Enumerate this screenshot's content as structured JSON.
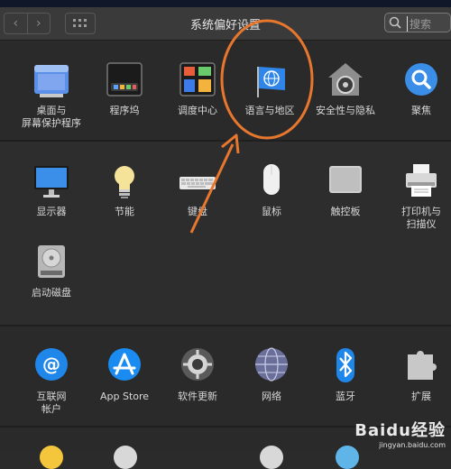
{
  "window": {
    "title": "系统偏好设置"
  },
  "toolbar": {
    "back": "‹",
    "forward": "›"
  },
  "search": {
    "placeholder": "搜索"
  },
  "rows": {
    "r1": [
      {
        "label": "桌面与\n屏幕保护程序",
        "icon": "desktop-screensaver-icon"
      },
      {
        "label": "程序坞",
        "icon": "dock-icon"
      },
      {
        "label": "调度中心",
        "icon": "mission-control-icon"
      },
      {
        "label": "语言与地区",
        "icon": "language-region-icon"
      },
      {
        "label": "安全性与隐私",
        "icon": "security-privacy-icon"
      },
      {
        "label": "聚焦",
        "icon": "spotlight-icon"
      }
    ],
    "r2": [
      {
        "label": "显示器",
        "icon": "displays-icon"
      },
      {
        "label": "节能",
        "icon": "energy-saver-icon"
      },
      {
        "label": "键盘",
        "icon": "keyboard-icon"
      },
      {
        "label": "鼠标",
        "icon": "mouse-icon"
      },
      {
        "label": "触控板",
        "icon": "trackpad-icon"
      },
      {
        "label": "打印机与\n扫描仪",
        "icon": "printers-scanners-icon"
      }
    ],
    "r3": [
      {
        "label": "启动磁盘",
        "icon": "startup-disk-icon"
      }
    ],
    "r4": [
      {
        "label": "互联网\n帐户",
        "icon": "internet-accounts-icon"
      },
      {
        "label": "App Store",
        "icon": "app-store-icon"
      },
      {
        "label": "软件更新",
        "icon": "software-update-icon"
      },
      {
        "label": "网络",
        "icon": "network-icon"
      },
      {
        "label": "蓝牙",
        "icon": "bluetooth-icon"
      },
      {
        "label": "扩展",
        "icon": "extensions-icon"
      }
    ]
  },
  "watermark": {
    "brand": "Baidu经验",
    "url": "jingyan.baidu.com"
  },
  "colors": {
    "annotation": "#e8772e",
    "accent": "#2f7fe0"
  }
}
